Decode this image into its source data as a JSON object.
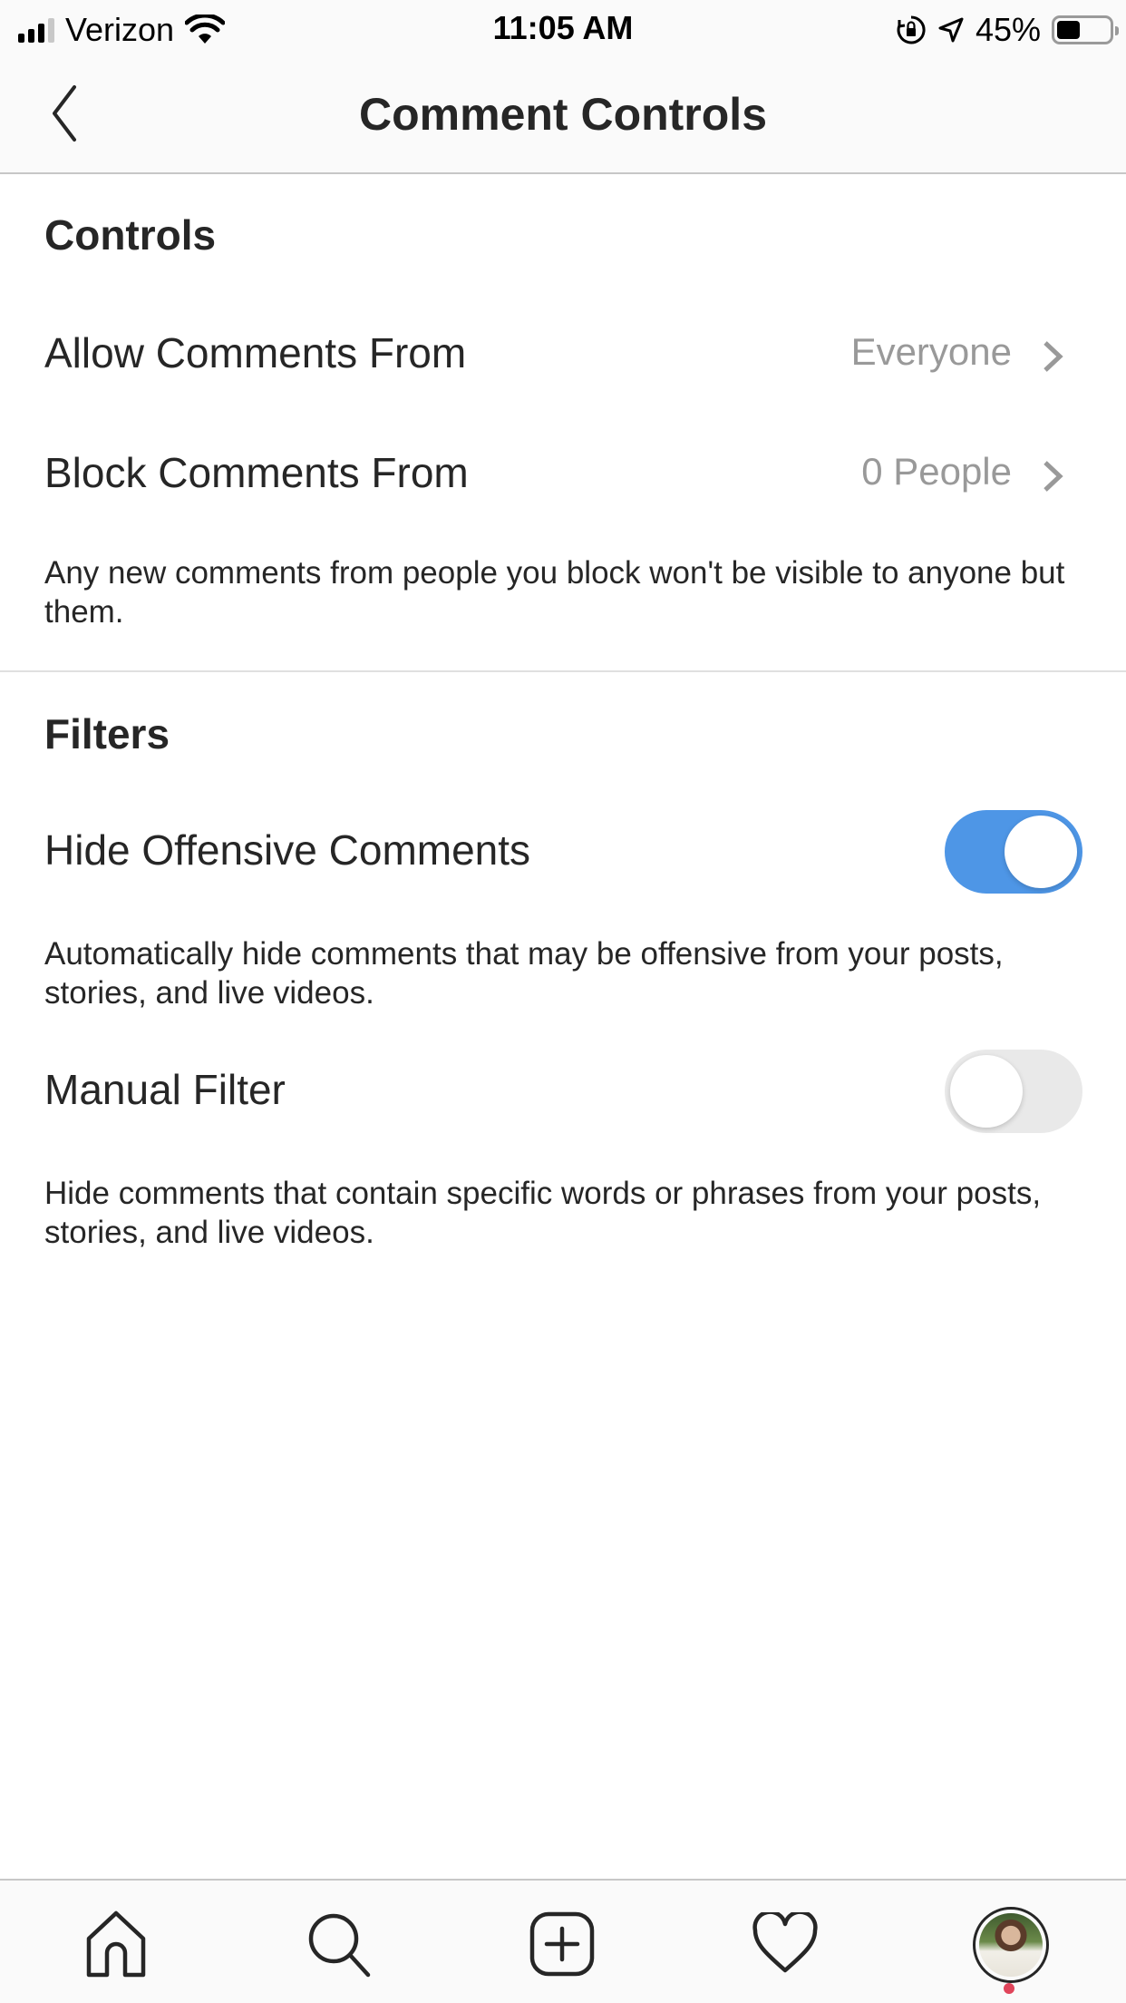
{
  "status_bar": {
    "carrier": "Verizon",
    "time": "11:05 AM",
    "battery_percent": "45%",
    "battery_level": 0.45,
    "icons": [
      "signal-icon",
      "wifi-icon",
      "orientation-lock-icon",
      "location-icon",
      "battery-icon"
    ]
  },
  "header": {
    "title": "Comment Controls",
    "back_icon": "chevron-left-icon"
  },
  "controls": {
    "heading": "Controls",
    "items": [
      {
        "label": "Allow Comments From",
        "value": "Everyone",
        "icon": "chevron-right-icon"
      },
      {
        "label": "Block Comments From",
        "value": "0 People",
        "icon": "chevron-right-icon"
      }
    ],
    "description": "Any new comments from people you block won't be visible to anyone but them."
  },
  "filters": {
    "heading": "Filters",
    "items": [
      {
        "label": "Hide Offensive Comments",
        "enabled": true,
        "description": "Automatically hide comments that may be offensive from your posts, stories, and live videos."
      },
      {
        "label": "Manual Filter",
        "enabled": false,
        "description": "Hide comments that contain specific words or phrases from your posts, stories, and live videos."
      }
    ],
    "toggle_on_color": "#4e96e6",
    "toggle_off_color": "#e9e9e9"
  },
  "tab_bar": {
    "tabs": [
      {
        "name": "home",
        "icon": "home-icon"
      },
      {
        "name": "search",
        "icon": "search-icon"
      },
      {
        "name": "new-post",
        "icon": "plus-square-icon"
      },
      {
        "name": "activity",
        "icon": "heart-icon"
      },
      {
        "name": "profile",
        "icon": "avatar"
      }
    ],
    "notification_dot_color": "#e0445a"
  }
}
